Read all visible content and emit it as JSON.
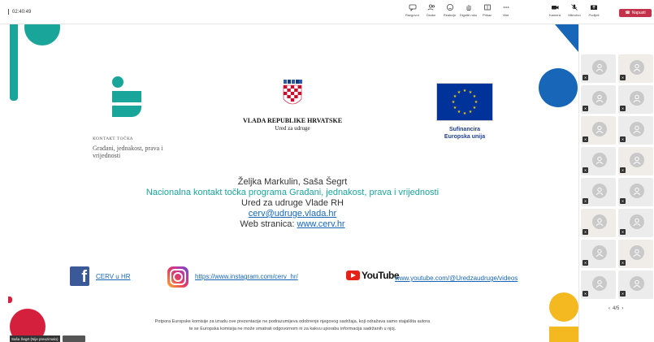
{
  "meeting": {
    "timer": "02:40:49",
    "toolbar": {
      "chat": "Razgovor",
      "people": "Osobe",
      "reactions": "Reakcije",
      "raise": "Dignite ruku",
      "view": "Prikaz",
      "rooms": "Sobe",
      "more": "Više",
      "camera": "Kamera",
      "mic": "Mikrofon",
      "share": "Podijeli",
      "leave": "Napusti"
    },
    "presenter_tag": "Saša Šegrt (Nije preuzimalo)"
  },
  "slide": {
    "kontakt_tocka_title": "KONTAKT TOČKA",
    "kontakt_tocka_sub": "Građani, jednakost, prava i vrijednosti",
    "vlada_title": "VLADA REPUBLIKE HRVATSKE",
    "vlada_sub": "Ured za udruge",
    "eu_line1": "Sufinancira",
    "eu_line2": "Europska unija",
    "names": "Željka Markulin, Saša Šegrt",
    "program": "Nacionalna kontakt točka programa Građani, jednakost, prava i vrijednosti",
    "office": "Ured za udruge Vlade RH",
    "email": "cerv@udruge.vlada.hr",
    "web_label": "Web stranica:",
    "web_url": "www.cerv.hr",
    "facebook_link": "CERV u HR",
    "instagram_link": "https://www.instagram.com/cerv_hr/",
    "youtube_word": "YouTube",
    "youtube_link": "www.youtube.com/@Uredzaudruge/videos",
    "disclaimer_line1": "Potpora Europske komisije za izradu ove prezentacije ne podrazumijeva odobrenje njegovog sadržaja, koji odražava samo stajališta autora",
    "disclaimer_line2": "te se Europska komisija ne može smatrati odgovornom ni za kakvu uporabu informacija sadržanih u njoj."
  },
  "participants": {
    "count": 16,
    "pager": "4/5"
  },
  "colors": {
    "teal": "#1aa59a",
    "blue": "#1766b7",
    "red": "#d4203c",
    "yellow": "#f4b820",
    "leave": "#c4314b"
  }
}
